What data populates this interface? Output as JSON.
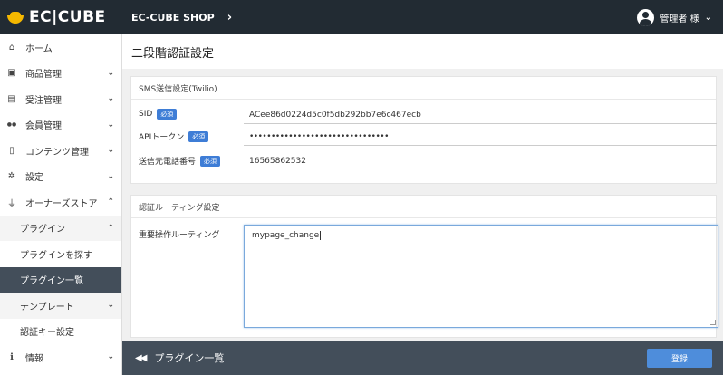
{
  "header": {
    "logo": "EC|CUBE",
    "shop_name": "EC-CUBE SHOP",
    "shop_chevron": "›",
    "user_label": "管理者 様",
    "user_chevron": "⌄"
  },
  "sidebar": {
    "items": [
      {
        "label": "ホーム",
        "icon": "home-icon",
        "glyph": "⌂",
        "chevron": ""
      },
      {
        "label": "商品管理",
        "icon": "box-icon",
        "glyph": "▣",
        "chevron": "⌄"
      },
      {
        "label": "受注管理",
        "icon": "cart-icon",
        "glyph": "▤",
        "chevron": "⌄"
      },
      {
        "label": "会員管理",
        "icon": "users-icon",
        "glyph": "●●",
        "chevron": "⌄"
      },
      {
        "label": "コンテンツ管理",
        "icon": "file-icon",
        "glyph": "▯",
        "chevron": "⌄"
      },
      {
        "label": "設定",
        "icon": "gear-icon",
        "glyph": "✲",
        "chevron": "⌄"
      },
      {
        "label": "オーナーズストア",
        "icon": "plug-icon",
        "glyph": "⏚",
        "chevron": "⌃"
      },
      {
        "label": "プラグイン",
        "icon": "",
        "glyph": "",
        "chevron": "⌃"
      },
      {
        "label": "プラグインを探す",
        "icon": "",
        "glyph": "",
        "chevron": ""
      },
      {
        "label": "プラグイン一覧",
        "icon": "",
        "glyph": "",
        "chevron": ""
      },
      {
        "label": "テンプレート",
        "icon": "",
        "glyph": "",
        "chevron": "⌄"
      },
      {
        "label": "認証キー設定",
        "icon": "",
        "glyph": "",
        "chevron": ""
      },
      {
        "label": "情報",
        "icon": "info-icon",
        "glyph": "ℹ",
        "chevron": "⌄"
      }
    ]
  },
  "main": {
    "title": "二段階認証設定",
    "sms_card": {
      "header": "SMS送信設定(Twilio)",
      "required_badge": "必須",
      "sid_label": "SID",
      "sid_value": "ACee86d0224d5c0f5db292bb7e6c467ecb",
      "api_token_label": "APIトークン",
      "api_token_value": "••••••••••••••••••••••••••••••••",
      "phone_label": "送信元電話番号",
      "phone_value": "16565862532"
    },
    "routing_card": {
      "header": "認証ルーティング設定",
      "routes_label": "重要操作ルーティング",
      "routes_value": "mypage_change"
    }
  },
  "footer": {
    "back_arrows": "◀◀",
    "back_label": "プラグイン一覧",
    "register_label": "登録"
  }
}
